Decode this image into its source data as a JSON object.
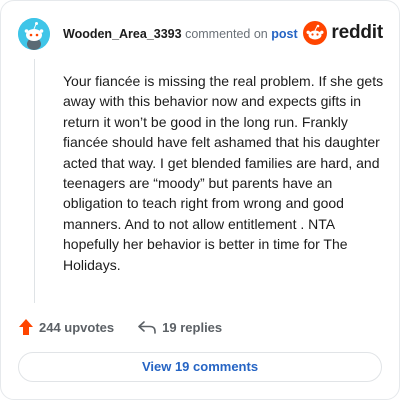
{
  "header": {
    "username": "Wooden_Area_3393",
    "commented_text": "commented on",
    "post_link": "post",
    "brand_wordmark": "reddit"
  },
  "comment": {
    "text": "Your fiancée is missing the real problem. If she gets away with this behavior now and expects gifts in return it won’t be good in the long run. Frankly fiancée should have felt ashamed that his daughter acted that way. I get blended families are hard, and teenagers are “moody” but parents have an obligation to teach right from wrong and good manners. And to not allow entitlement . NTA hopefully her behavior is better in time for The Holidays."
  },
  "actions": {
    "upvotes": "244 upvotes",
    "replies": "19 replies"
  },
  "view_button": "View 19 comments",
  "colors": {
    "accent": "#ff4500",
    "link": "#2564c4",
    "avatar": "#3fc5e8"
  },
  "icons": [
    "snoo-avatar-icon",
    "reddit-logo-icon",
    "upvote-arrow-icon",
    "reply-arrow-icon"
  ]
}
